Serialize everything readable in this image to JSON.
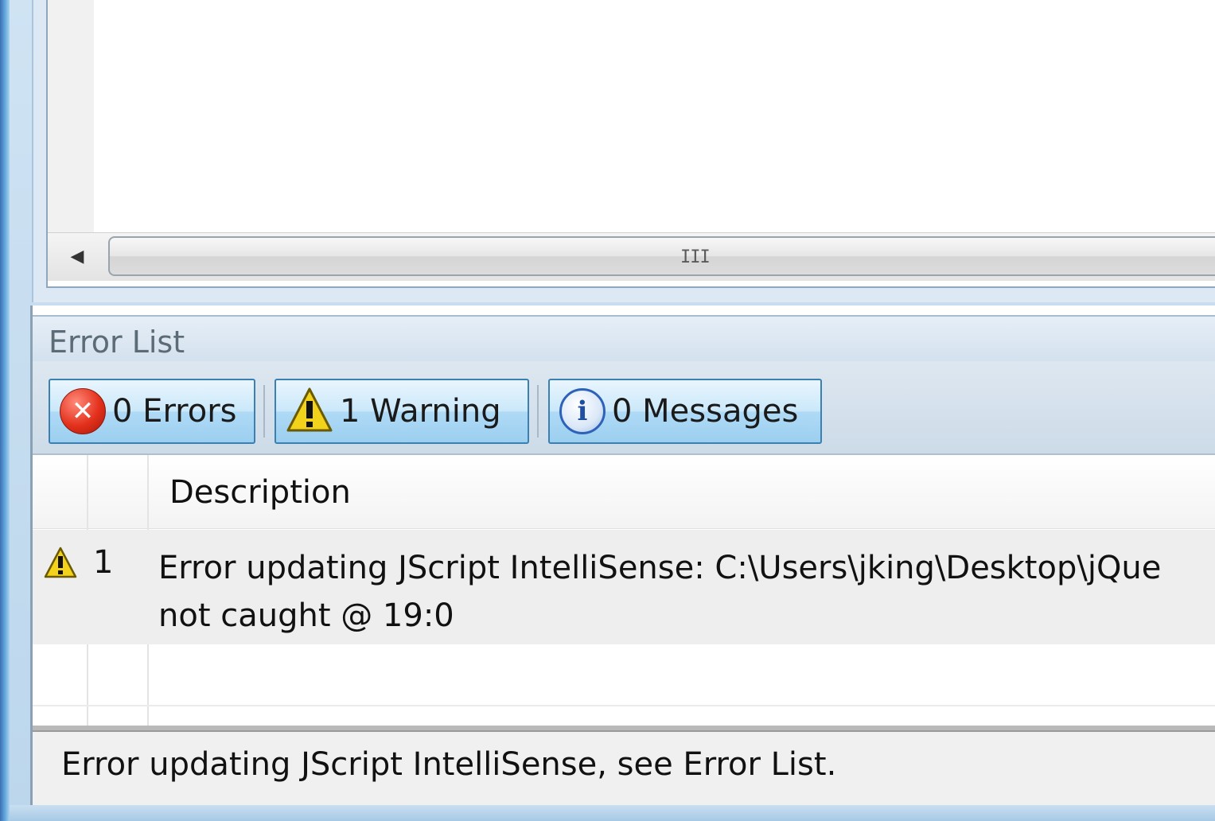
{
  "error_list": {
    "title": "Error List",
    "filters": {
      "errors_label": "0 Errors",
      "warnings_label": "1 Warning",
      "messages_label": "0 Messages"
    },
    "columns": {
      "description": "Description"
    },
    "rows": [
      {
        "number": "1",
        "severity_icon": "warning-icon",
        "description_line1": "Error updating JScript IntelliSense: C:\\Users\\jking\\Desktop\\jQue",
        "description_line2": "not caught @ 19:0"
      }
    ]
  },
  "editor": {
    "scrollbar_grip": "III"
  },
  "status_bar": {
    "text": "Error updating JScript IntelliSense, see Error List."
  },
  "colors": {
    "button_border": "#3c7fb1",
    "button_fill": "#afdaf6",
    "error_red": "#e3311c",
    "warning_yellow": "#f2d21a",
    "info_blue": "#2d62b8"
  }
}
